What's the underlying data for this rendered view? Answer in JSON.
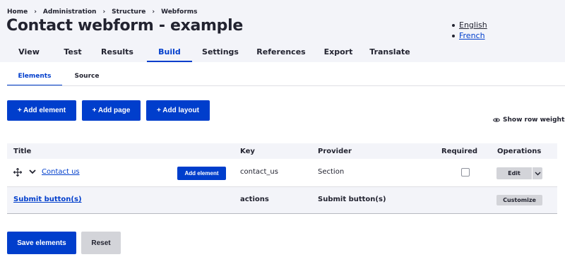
{
  "breadcrumb": [
    {
      "label": "Home"
    },
    {
      "label": "Administration"
    },
    {
      "label": "Structure"
    },
    {
      "label": "Webforms"
    }
  ],
  "breadcrumb_separator": "›",
  "page_title": "Contact webform - example",
  "languages": [
    {
      "label": "English"
    },
    {
      "label": "French"
    }
  ],
  "primary_tabs": [
    {
      "label": "View"
    },
    {
      "label": "Test"
    },
    {
      "label": "Results"
    },
    {
      "label": "Build",
      "active": true
    },
    {
      "label": "Settings"
    },
    {
      "label": "References"
    },
    {
      "label": "Export"
    },
    {
      "label": "Translate"
    }
  ],
  "secondary_tabs": [
    {
      "label": "Elements",
      "active": true
    },
    {
      "label": "Source"
    }
  ],
  "actions": {
    "add_element": "+ Add element",
    "add_page": "+ Add page",
    "add_layout": "+ Add layout"
  },
  "show_row_weights": "Show row weights",
  "table": {
    "headers": {
      "title": "Title",
      "key": "Key",
      "provider": "Provider",
      "required": "Required",
      "operations": "Operations"
    },
    "rows": [
      {
        "title": "Contact us",
        "add_element_label": "Add element",
        "key": "contact_us",
        "provider": "Section",
        "required": false,
        "operation": "Edit"
      },
      {
        "title": "Submit button(s)",
        "key": "actions",
        "provider": "Submit button(s)",
        "operation": "Customize"
      }
    ]
  },
  "footer": {
    "save": "Save elements",
    "reset": "Reset"
  },
  "colors": {
    "accent": "#003ecc",
    "header_bg": "#f3f4f9",
    "secondary_button": "#d3d4d9",
    "text": "#222330"
  }
}
